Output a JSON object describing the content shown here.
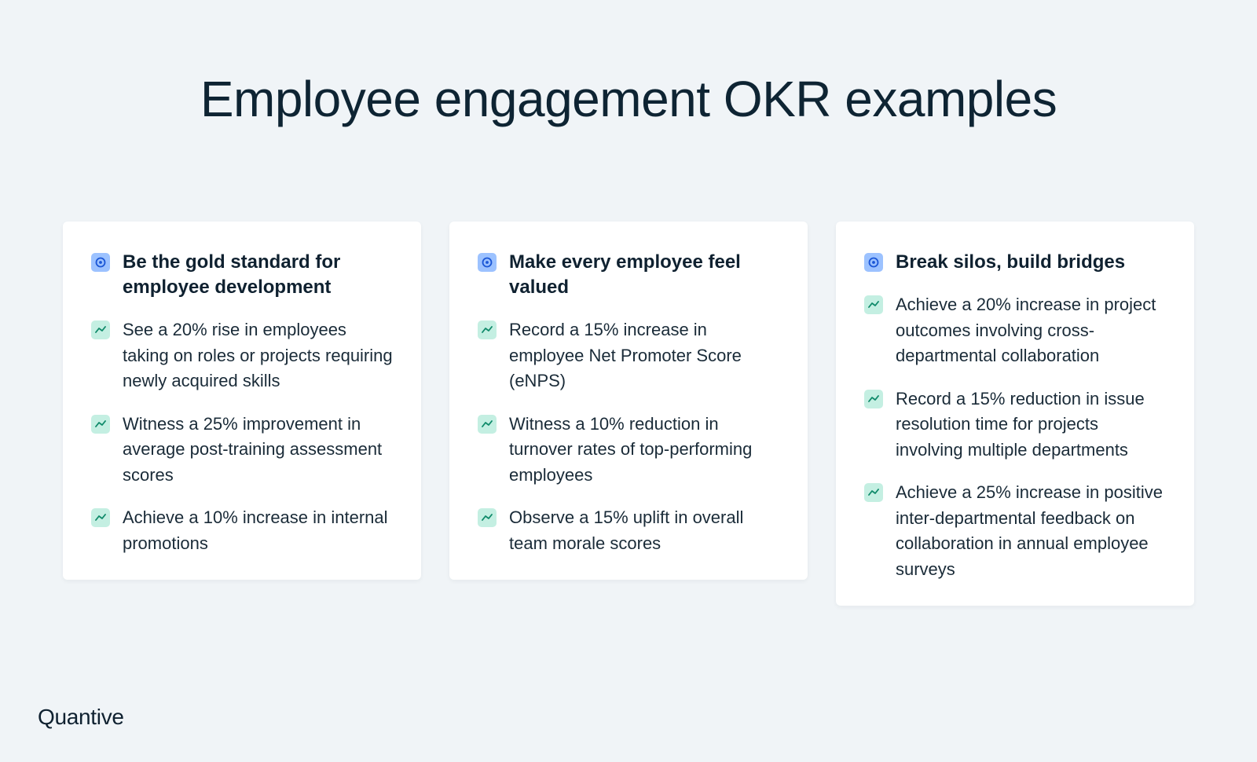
{
  "title": "Employee engagement OKR examples",
  "brand": "Quantive",
  "colors": {
    "background": "#f0f4f7",
    "objective_icon_bg": "#9cc2ff",
    "objective_icon_fg": "#1a56d6",
    "key_result_icon_bg": "#c4efe2",
    "key_result_icon_fg": "#0f8a6a"
  },
  "icons": {
    "objective": "target-icon",
    "key_result": "trend-icon"
  },
  "cards": [
    {
      "objective": "Be the gold standard for employee development",
      "key_results": [
        "See a 20% rise in employees taking on roles or projects requiring newly acquired skills",
        "Witness a 25% improvement in average post-training assessment scores",
        "Achieve a 10% increase in internal promotions"
      ]
    },
    {
      "objective": "Make every employee feel valued",
      "key_results": [
        "Record a 15% increase in employee Net Promoter Score (eNPS)",
        "Witness a 10% reduction in turnover rates of top-performing employees",
        "Observe a 15% uplift in overall team morale scores"
      ]
    },
    {
      "objective": "Break silos, build bridges",
      "key_results": [
        "Achieve a 20% increase in project outcomes involving cross-departmental collaboration",
        "Record a 15% reduction in issue resolution time for projects involving multiple departments",
        "Achieve a 25% increase in positive inter-departmental feedback on collaboration in annual employee surveys"
      ]
    }
  ]
}
